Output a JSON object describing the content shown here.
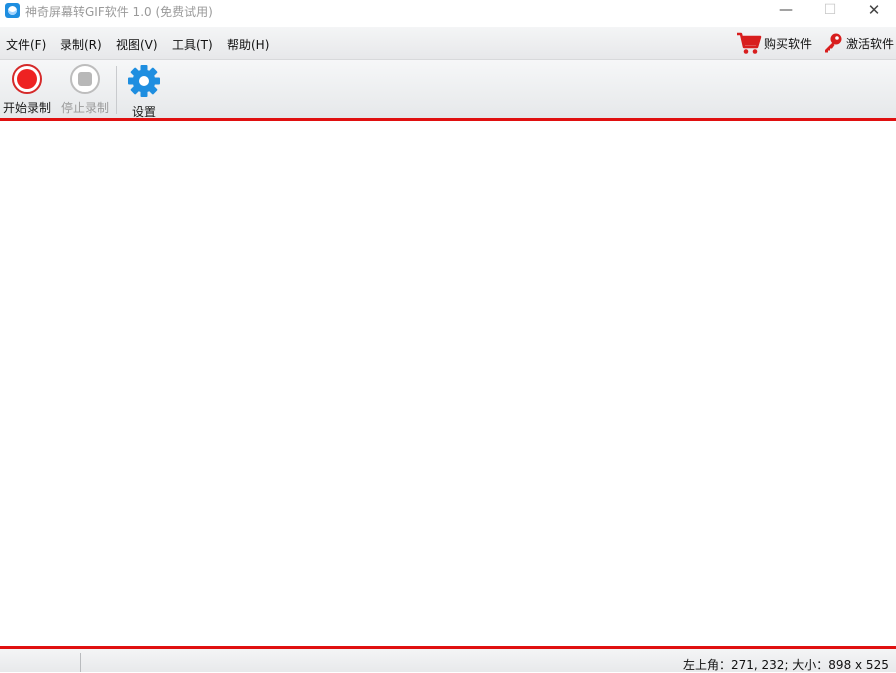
{
  "window": {
    "title": "神奇屏幕转GIF软件 1.0 (免费试用)",
    "controls": {
      "minimize": "—",
      "maximize": "☐",
      "close": "✕"
    }
  },
  "menu": {
    "items": [
      {
        "label": "文件(F)"
      },
      {
        "label": "录制(R)"
      },
      {
        "label": "视图(V)"
      },
      {
        "label": "工具(T)"
      },
      {
        "label": "帮助(H)"
      }
    ],
    "buy_label": "购买软件",
    "activate_label": "激活软件"
  },
  "toolbar": {
    "start_label": "开始录制",
    "stop_label": "停止录制",
    "settings_label": "设置"
  },
  "status": {
    "text": "左上角：271, 232; 大小：898 x 525"
  },
  "colors": {
    "accent_red": "#e01010",
    "settings_blue": "#1e8ee0",
    "cart_red": "#d81e1e"
  },
  "icons": [
    "app-icon",
    "cart-icon",
    "key-icon",
    "record-icon",
    "stop-icon",
    "gear-icon"
  ]
}
